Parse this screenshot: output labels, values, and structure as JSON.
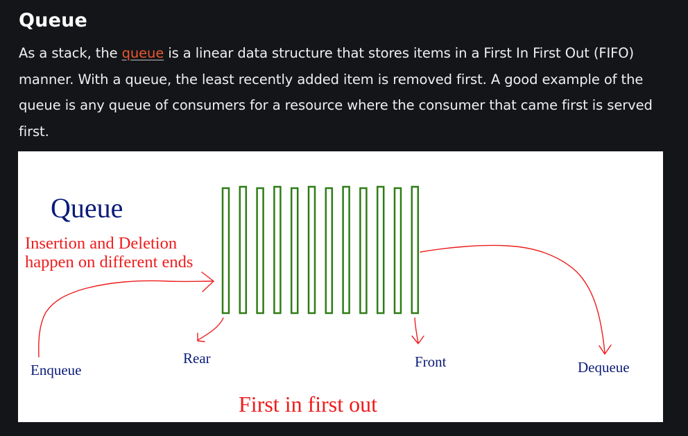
{
  "section": {
    "title": "Queue",
    "para_before": "As a stack, the ",
    "link_text": "queue",
    "para_after": " is a linear data structure that stores items in a First In First Out (FIFO) manner. With a queue, the least recently added item is removed first. A good example of the queue is any queue of consumers for a resource where the consumer that came first is served first."
  },
  "figure": {
    "title": "Queue",
    "desc_line1": "Insertion and Deletion",
    "desc_line2": "happen on different ends",
    "enqueue": "Enqueue",
    "rear": "Rear",
    "front": "Front",
    "dequeue": "Dequeue",
    "fifo": "First in first out",
    "slot_count": 12
  },
  "colors": {
    "background": "#141519",
    "link": "#e8572e",
    "slot_stroke": "#2e7d15",
    "arrow": "#ee1c1c",
    "label_blue": "#0a1b78"
  }
}
